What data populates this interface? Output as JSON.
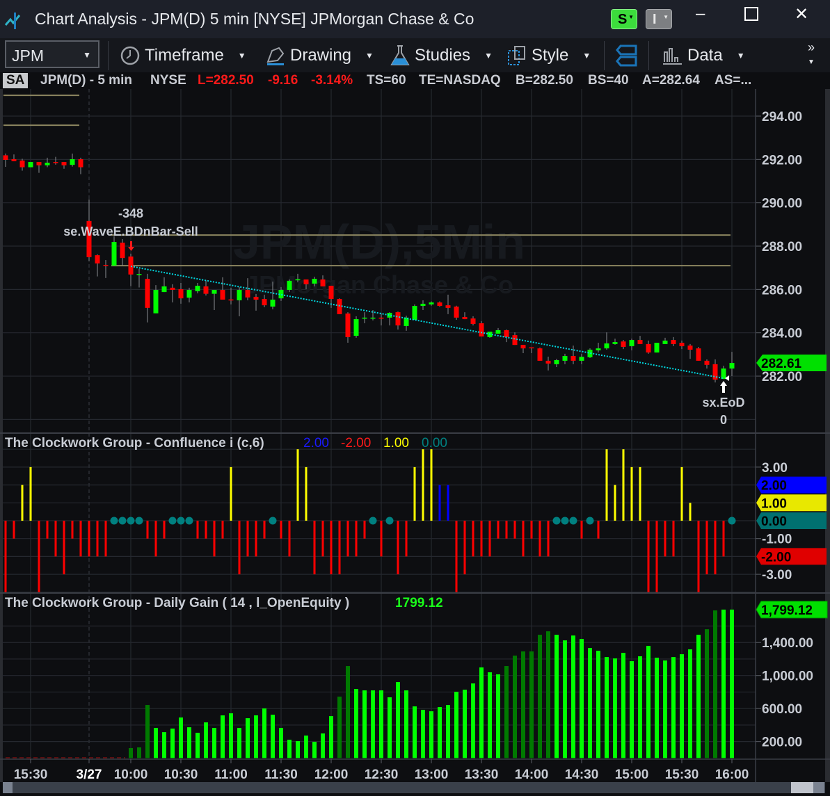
{
  "window": {
    "title": "Chart Analysis - JPM(D) 5 min [NYSE] JPMorgan Chase & Co",
    "s_button": "S",
    "i_button": "I"
  },
  "toolbar": {
    "symbol": "JPM",
    "timeframe": "Timeframe",
    "drawing": "Drawing",
    "studies": "Studies",
    "style": "Style",
    "data": "Data"
  },
  "status": {
    "badge": "SA",
    "symbol": "JPM(D) - 5 min",
    "exchange": "NYSE",
    "last": "L=282.50",
    "change": "-9.16",
    "pct": "-3.14%",
    "ts": "TS=60",
    "te": "TE=NASDAQ",
    "bid": "B=282.50",
    "bs": "BS=40",
    "ask": "A=282.64",
    "as": "AS=..."
  },
  "colors": {
    "up": "#00ff00",
    "down": "#ff0000",
    "level": "#8c8660",
    "trend": "#00d8e0",
    "blue": "#0000ff",
    "yellow": "#ffff00",
    "teal": "#008080",
    "gain": "#00ff00",
    "gain_dark": "#007a00"
  },
  "chart_data": [
    {
      "type": "candlestick",
      "title": "JPM(D),5Min",
      "subtitle": "JPMorgan Chase & Co",
      "ylim": [
        280,
        294
      ],
      "y_ticks": [
        "294.00",
        "292.00",
        "290.00",
        "288.00",
        "286.00",
        "284.00",
        "282.00"
      ],
      "y_tick_values": [
        294,
        292,
        290,
        288,
        286,
        284,
        282
      ],
      "last_price_tag": "282.61",
      "x_ticks": [
        {
          "label": "15:30",
          "bar": 3
        },
        {
          "label": "3/27",
          "bar": 10
        },
        {
          "label": "10:00",
          "bar": 15
        },
        {
          "label": "10:30",
          "bar": 21
        },
        {
          "label": "11:00",
          "bar": 27
        },
        {
          "label": "11:30",
          "bar": 33
        },
        {
          "label": "12:00",
          "bar": 39
        },
        {
          "label": "12:30",
          "bar": 45
        },
        {
          "label": "13:00",
          "bar": 51
        },
        {
          "label": "13:30",
          "bar": 57
        },
        {
          "label": "14:00",
          "bar": 63
        },
        {
          "label": "14:30",
          "bar": 69
        },
        {
          "label": "15:00",
          "bar": 75
        },
        {
          "label": "15:30",
          "bar": 81
        },
        {
          "label": "16:00",
          "bar": 87
        }
      ],
      "session_break_bar": 10,
      "ohlc": [
        [
          292.19,
          292.27,
          291.66,
          291.98
        ],
        [
          292.01,
          292.23,
          291.92,
          291.92
        ],
        [
          291.95,
          292.03,
          291.48,
          291.64
        ],
        [
          291.64,
          291.88,
          291.64,
          291.88
        ],
        [
          291.88,
          291.88,
          291.38,
          291.73
        ],
        [
          291.73,
          292.08,
          291.64,
          291.85
        ],
        [
          291.88,
          292.12,
          291.76,
          291.86
        ],
        [
          291.88,
          291.88,
          291.57,
          291.73
        ],
        [
          291.75,
          292.27,
          291.67,
          292.01
        ],
        [
          292.01,
          292.08,
          291.32,
          291.64
        ],
        [
          289.16,
          290.16,
          287.3,
          287.49
        ],
        [
          287.58,
          287.62,
          286.6,
          287.2
        ],
        [
          287.13,
          287.36,
          286.53,
          287.11
        ],
        [
          287.1,
          288.45,
          287.1,
          288.19
        ],
        [
          288.16,
          288.32,
          287.1,
          287.45
        ],
        [
          287.52,
          287.65,
          286.15,
          286.69
        ],
        [
          286.67,
          286.95,
          286.09,
          286.71
        ],
        [
          286.49,
          286.72,
          284.48,
          285.15
        ],
        [
          284.9,
          286.2,
          284.9,
          285.98
        ],
        [
          285.88,
          286.56,
          285.88,
          286.14
        ],
        [
          286.08,
          286.24,
          285.4,
          285.98
        ],
        [
          286.01,
          286.3,
          285.34,
          285.59
        ],
        [
          285.62,
          286.08,
          285.4,
          285.98
        ],
        [
          285.92,
          286.3,
          285.82,
          286.17
        ],
        [
          286.14,
          286.42,
          285.72,
          285.8
        ],
        [
          285.8,
          285.98,
          285.05,
          285.98
        ],
        [
          285.98,
          286.56,
          285.53,
          285.53
        ],
        [
          285.54,
          286.08,
          285.31,
          285.51
        ],
        [
          285.5,
          286.11,
          284.76,
          285.98
        ],
        [
          285.98,
          286.52,
          285.5,
          285.63
        ],
        [
          285.66,
          285.79,
          285.02,
          285.53
        ],
        [
          285.56,
          285.76,
          285.18,
          285.27
        ],
        [
          285.21,
          286.36,
          285.08,
          285.53
        ],
        [
          285.59,
          286.11,
          285.47,
          285.98
        ],
        [
          285.98,
          286.46,
          285.88,
          286.4
        ],
        [
          286.43,
          286.72,
          286.33,
          286.47
        ],
        [
          286.46,
          286.46,
          286.01,
          286.24
        ],
        [
          286.27,
          286.59,
          286.14,
          286.49
        ],
        [
          286.46,
          286.65,
          286.14,
          286.14
        ],
        [
          286.17,
          286.17,
          285.15,
          285.56
        ],
        [
          285.56,
          285.59,
          284.86,
          284.86
        ],
        [
          284.89,
          284.95,
          283.54,
          283.8
        ],
        [
          283.86,
          284.76,
          283.77,
          284.63
        ],
        [
          284.67,
          284.95,
          284.44,
          284.7
        ],
        [
          284.68,
          285.05,
          284.57,
          284.7
        ],
        [
          284.7,
          284.89,
          284.34,
          284.68
        ],
        [
          284.7,
          284.95,
          284.34,
          284.92
        ],
        [
          284.95,
          284.98,
          284.15,
          284.34
        ],
        [
          284.31,
          284.79,
          284.09,
          284.7
        ],
        [
          284.6,
          285.31,
          284.6,
          285.24
        ],
        [
          285.24,
          285.5,
          285.05,
          285.34
        ],
        [
          285.31,
          285.45,
          285.25,
          285.4
        ],
        [
          285.4,
          285.45,
          285.2,
          285.24
        ],
        [
          285.27,
          285.76,
          284.86,
          285.15
        ],
        [
          285.21,
          285.25,
          284.6,
          284.7
        ],
        [
          284.73,
          284.95,
          284.63,
          284.63
        ],
        [
          284.66,
          284.76,
          284.34,
          284.41
        ],
        [
          284.44,
          284.54,
          283.83,
          283.83
        ],
        [
          283.8,
          284.05,
          283.77,
          284.05
        ],
        [
          283.96,
          284.22,
          283.96,
          284.12
        ],
        [
          284.12,
          284.15,
          283.57,
          283.8
        ],
        [
          283.89,
          284.02,
          283.44,
          283.44
        ],
        [
          283.44,
          283.44,
          283.06,
          283.28
        ],
        [
          283.33,
          283.33,
          283.06,
          283.31
        ],
        [
          283.28,
          283.32,
          282.71,
          282.71
        ],
        [
          282.71,
          282.9,
          282.26,
          282.58
        ],
        [
          282.55,
          282.8,
          282.42,
          282.74
        ],
        [
          282.71,
          283.03,
          282.55,
          282.93
        ],
        [
          282.93,
          283.41,
          282.55,
          282.71
        ],
        [
          282.71,
          283.03,
          282.55,
          282.89
        ],
        [
          282.87,
          283.28,
          282.84,
          283.22
        ],
        [
          283.19,
          283.54,
          283.09,
          283.28
        ],
        [
          283.28,
          284.02,
          283.22,
          283.51
        ],
        [
          283.48,
          283.73,
          283.45,
          283.57
        ],
        [
          283.6,
          283.67,
          283.25,
          283.35
        ],
        [
          283.38,
          283.73,
          283.19,
          283.67
        ],
        [
          283.67,
          283.86,
          283.48,
          283.48
        ],
        [
          283.48,
          283.64,
          283.03,
          283.09
        ],
        [
          283.09,
          283.54,
          283.09,
          283.54
        ],
        [
          283.48,
          283.77,
          283.48,
          283.64
        ],
        [
          283.67,
          283.8,
          283.38,
          283.48
        ],
        [
          283.54,
          283.64,
          283.25,
          283.38
        ],
        [
          283.41,
          283.48,
          282.8,
          283.22
        ],
        [
          283.28,
          283.35,
          282.71,
          282.71
        ],
        [
          282.71,
          282.77,
          282.35,
          282.52
        ],
        [
          282.55,
          282.77,
          281.71,
          281.84
        ],
        [
          281.87,
          282.48,
          281.87,
          282.35
        ],
        [
          282.35,
          283.12,
          282.0,
          282.61
        ]
      ],
      "levels": [
        {
          "price": 294.96,
          "from_bar": 0,
          "to_bar": 9
        },
        {
          "price": 293.58,
          "from_bar": 0,
          "to_bar": 9
        },
        {
          "price": 288.51,
          "from_bar": 13,
          "to_bar": 87
        },
        {
          "price": 287.1,
          "from_bar": 13,
          "to_bar": 87
        }
      ],
      "trendline": {
        "from_bar": 15,
        "from_price": 287.07,
        "to_bar": 86,
        "to_price": 281.9
      },
      "entry": {
        "bar": 15,
        "label": "se.WaveE.BDnBar-Sell",
        "qty": "-348"
      },
      "exit": {
        "bar": 86,
        "label": "sx.EoD",
        "qty": "0"
      }
    },
    {
      "type": "bar",
      "title": "The Clockwork Group - Confluence i (c,6)",
      "legend_values": [
        "2.00",
        "-2.00",
        "1.00",
        "0.00"
      ],
      "ylim": [
        -4,
        4
      ],
      "y_ticks": [
        "3.00",
        "-1.00",
        "-3.00"
      ],
      "y_tick_values": [
        3,
        -1,
        -3
      ],
      "tags": [
        {
          "label": "2.00",
          "value": 2,
          "color": "#0000ff"
        },
        {
          "label": "1.00",
          "value": 1,
          "color": "#e8e800"
        },
        {
          "label": "0.00",
          "value": 0,
          "color": "#007070"
        },
        {
          "label": "-2.00",
          "value": -2,
          "color": "#e00000"
        }
      ],
      "blue_bars": [
        52,
        53
      ],
      "values": [
        -4,
        -1,
        2,
        3,
        -4,
        -1,
        -2,
        -3,
        -1,
        -2,
        -2,
        -2,
        -2,
        0,
        0,
        0,
        0,
        -1,
        -2,
        -1,
        0,
        0,
        0,
        -1,
        -1,
        -2,
        -1,
        3,
        -3,
        -2,
        -2,
        -1,
        0,
        -1,
        -2,
        4,
        3,
        -3,
        -2,
        -3,
        -3,
        -2,
        -2,
        -1,
        0,
        -2,
        0,
        -3,
        -2,
        3,
        4,
        4,
        2,
        2,
        -4,
        -3,
        -2,
        -2,
        -2,
        -1,
        -1,
        -1,
        -2,
        -1,
        -2,
        -2,
        0,
        0,
        0,
        -1,
        0,
        -1,
        4,
        2,
        4,
        3,
        3,
        -4,
        -4,
        -2,
        -2,
        3,
        1,
        -4,
        -3,
        -3,
        -2,
        0
      ]
    },
    {
      "type": "bar",
      "title": "The Clockwork Group - Daily Gain ( 14 , l_OpenEquity )",
      "legend_value": "1799.12",
      "last_tag": "1,799.12",
      "ylim": [
        0,
        1800
      ],
      "y_ticks": [
        "1,400.00",
        "1,000.00",
        "600.00",
        "200.00"
      ],
      "y_tick_values": [
        1400,
        1000,
        600,
        200
      ],
      "dark_bars": [
        15,
        16,
        17,
        40,
        41,
        60,
        61,
        62,
        63,
        64,
        65,
        84,
        85
      ],
      "values": [
        0,
        0,
        0,
        0,
        0,
        0,
        0,
        0,
        0,
        0,
        0,
        0,
        0,
        0,
        0,
        121,
        129,
        643,
        365,
        314,
        357,
        491,
        373,
        306,
        432,
        365,
        517,
        542,
        365,
        483,
        517,
        601,
        525,
        365,
        222,
        205,
        272,
        197,
        298,
        508,
        744,
        1115,
        837,
        820,
        820,
        820,
        736,
        921,
        820,
        626,
        584,
        567,
        618,
        643,
        803,
        828,
        904,
        1098,
        1039,
        1014,
        1115,
        1241,
        1292,
        1292,
        1494,
        1536,
        1494,
        1426,
        1485,
        1443,
        1334,
        1300,
        1224,
        1207,
        1275,
        1174,
        1233,
        1359,
        1216,
        1182,
        1224,
        1258,
        1317,
        1494,
        1561,
        1789,
        1799,
        1799.12
      ]
    }
  ]
}
